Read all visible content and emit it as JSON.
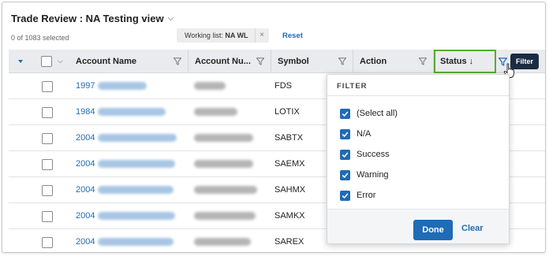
{
  "header": {
    "title": "Trade Review : NA Testing view",
    "selection_count": "0 of 1083 selected",
    "working_list_label": "Working list:",
    "working_list_value": "NA WL",
    "chip_close": "×",
    "reset_label": "Reset"
  },
  "columns": [
    {
      "label": "Account Name"
    },
    {
      "label": "Account Nu..."
    },
    {
      "label": "Symbol"
    },
    {
      "label": "Action"
    },
    {
      "label": "Status ↓"
    }
  ],
  "rows": [
    {
      "account_prefix": "1997",
      "symbol": "FDS"
    },
    {
      "account_prefix": "1984",
      "symbol": "LOTIX"
    },
    {
      "account_prefix": "2004",
      "symbol": "SABTX"
    },
    {
      "account_prefix": "2004",
      "symbol": "SAEMX"
    },
    {
      "account_prefix": "2004",
      "symbol": "SAHMX"
    },
    {
      "account_prefix": "2004",
      "symbol": "SAMKX"
    },
    {
      "account_prefix": "2004",
      "symbol": "SAREX"
    }
  ],
  "filter_popup": {
    "title": "FILTER",
    "options": [
      "(Select all)",
      "N/A",
      "Success",
      "Warning",
      "Error"
    ],
    "done_label": "Done",
    "clear_label": "Clear"
  },
  "tooltip": "Filter",
  "colors": {
    "accent": "#1f6bb5",
    "highlight_border": "#5aaa2f",
    "header_bg": "#e9ebee",
    "tooltip_bg": "#1b2c42"
  },
  "icons": [
    "chevron-down-icon",
    "filter-funnel-icon",
    "close-icon",
    "checkbox-checked-icon",
    "pointer-cursor-icon",
    "expand-caret-icon"
  ]
}
